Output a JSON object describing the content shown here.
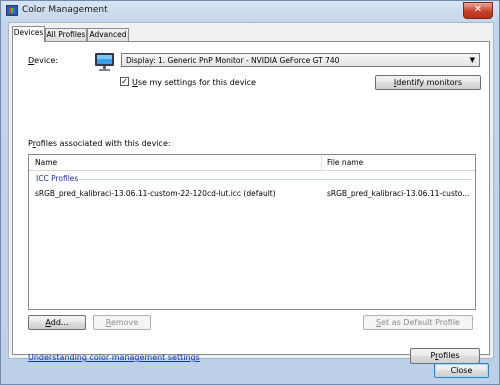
{
  "window": {
    "title": "Color Management",
    "close_glyph": "✕"
  },
  "tabs": [
    {
      "label": "Devices",
      "active": true
    },
    {
      "label": "All Profiles",
      "active": false
    },
    {
      "label": "Advanced",
      "active": false
    }
  ],
  "device": {
    "label_mnemonic": "D",
    "label_rest": "evice:",
    "selected": "Display: 1. Generic PnP Monitor - NVIDIA GeForce GT 740",
    "dropdown_glyph": "▼",
    "use_settings_mnemonic": "U",
    "use_settings_rest": "se my settings for this device",
    "use_settings_checked": true,
    "check_glyph": "✓",
    "identify_mnemonic": "I",
    "identify_rest": "dentify monitors"
  },
  "profiles": {
    "section_mnemonic": "r",
    "section_prefix": "P",
    "section_rest": "ofiles associated with this device:",
    "columns": {
      "name": "Name",
      "file": "File name"
    },
    "group": "ICC Profiles",
    "rows": [
      {
        "name": "sRGB_pred_kalibraci-13.06.11-custom-22-120cd-lut.icc (default)",
        "file": "sRGB_pred_kalibraci-13.06.11-custo..."
      }
    ]
  },
  "buttons": {
    "add_mnemonic": "A",
    "add_rest": "dd...",
    "remove_mnemonic": "R",
    "remove_rest": "emove",
    "set_default_mnemonic": "S",
    "set_default_rest": "et as Default Profile",
    "profiles_prefix": "P",
    "profiles_mnemonic": "r",
    "profiles_rest": "ofiles",
    "close": "Close"
  },
  "footer": {
    "link": "Understanding color management settings"
  },
  "colors": {
    "link": "#0b3cae",
    "group_header": "#1e3287",
    "close_button": "#c4412a"
  }
}
